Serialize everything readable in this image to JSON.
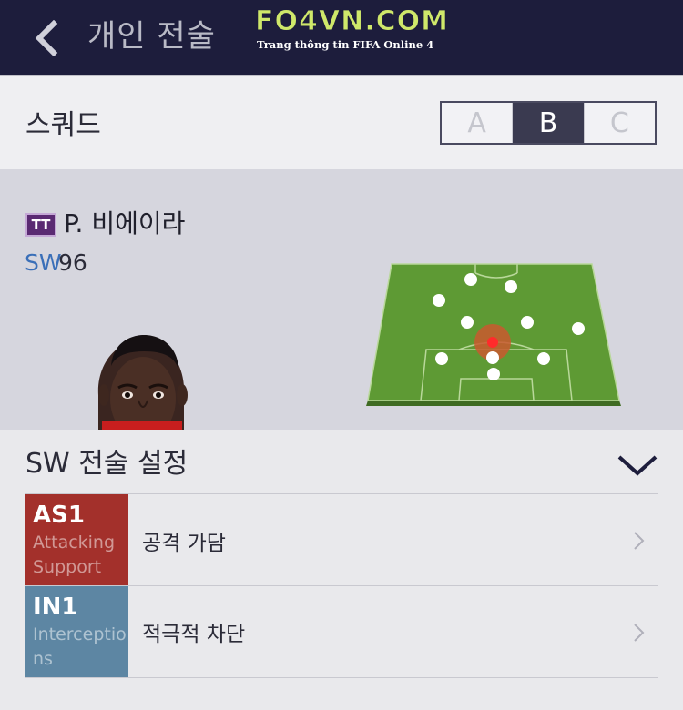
{
  "header": {
    "title": "개인 전술",
    "logo_text": "FO4VN.COM",
    "logo_sub": "Trang thông tin FIFA Online 4"
  },
  "squad": {
    "title": "스쿼드",
    "tabs": [
      {
        "label": "A",
        "active": false
      },
      {
        "label": "B",
        "active": true
      },
      {
        "label": "C",
        "active": false
      }
    ]
  },
  "player": {
    "badge": "TT",
    "name": "P. 비에이라",
    "position": "SW",
    "rating": "96"
  },
  "settings": {
    "title": "SW 전술 설정",
    "items": [
      {
        "code": "AS1",
        "desc": "Attacking Support",
        "label": "공격 가담",
        "color": "#a3302b"
      },
      {
        "code": "IN1",
        "desc": "Interceptions",
        "label": "적극적 차단",
        "color": "#5d86a3"
      }
    ]
  },
  "colors": {
    "header_bg": "#1d1d3c",
    "logo_green": "#cfe86a",
    "pitch_green": "#6aa23e",
    "highlight_red": "#e23b2e"
  }
}
